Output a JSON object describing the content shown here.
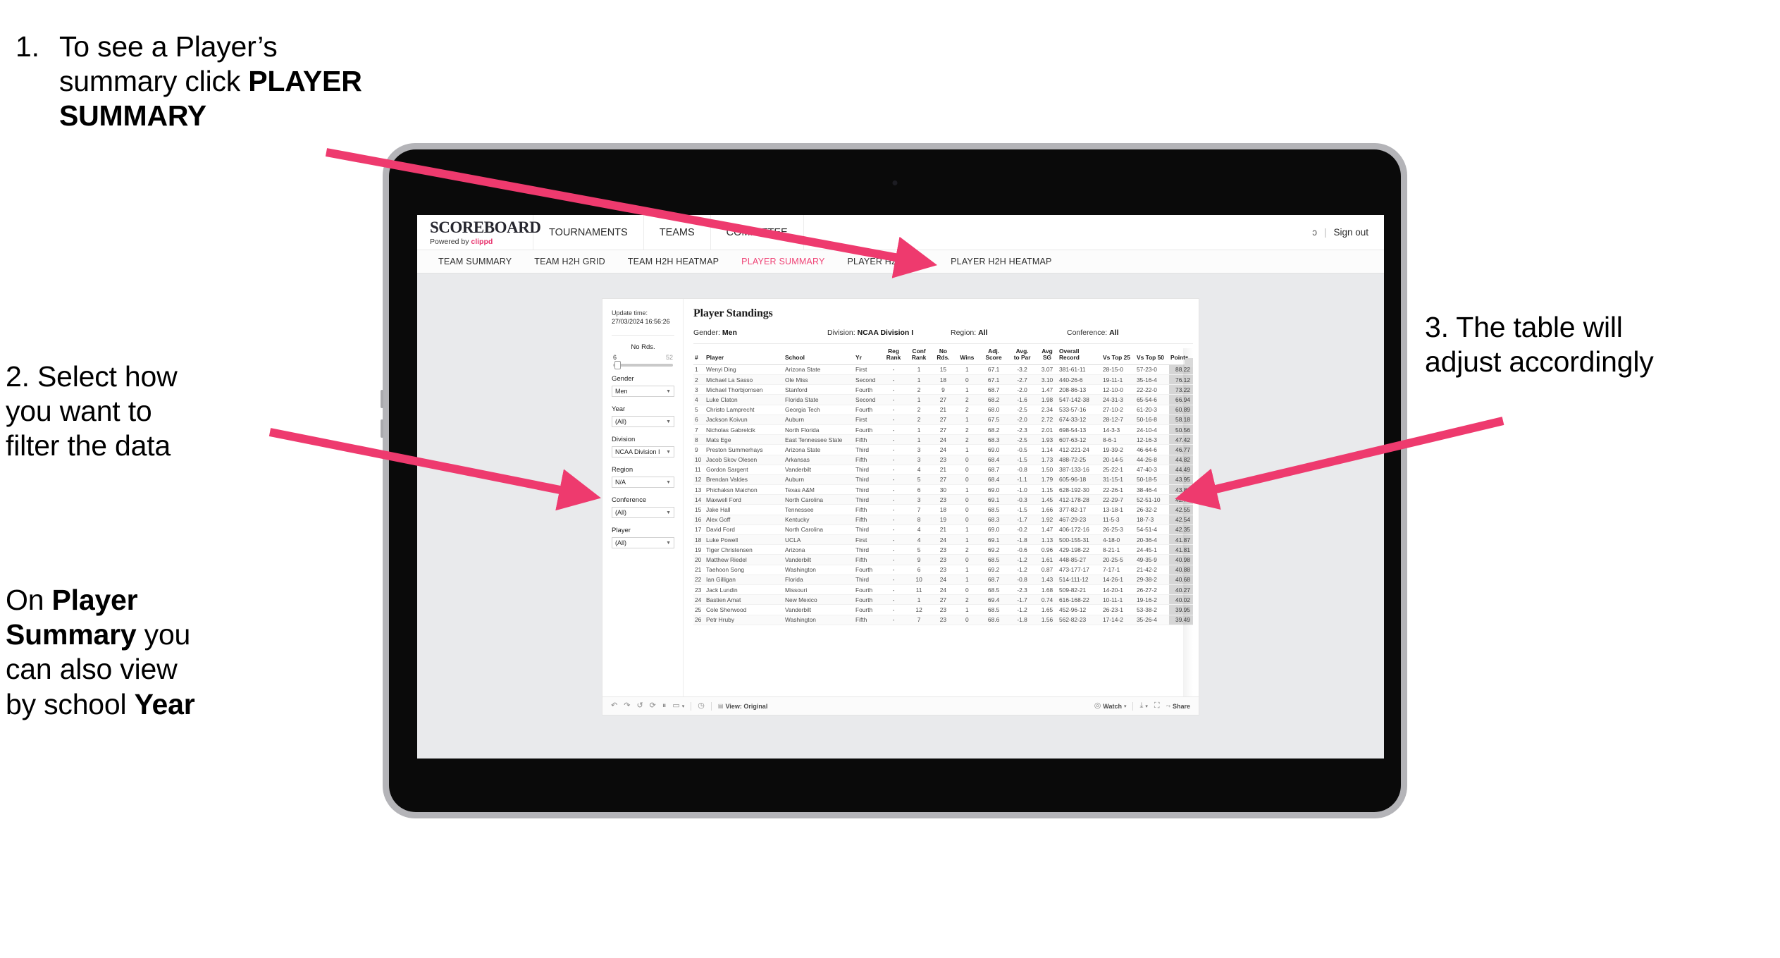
{
  "annotations": {
    "one": {
      "number": "1.",
      "line1": "To see a Player’s",
      "line2_pre": "summary click ",
      "line2_bold": "PLAYER",
      "line3_bold": "SUMMARY"
    },
    "two": {
      "line1": "2. Select how",
      "line2": "you want to",
      "line3": "filter the data"
    },
    "two_b": {
      "pre1": "On ",
      "bold1": "Player",
      "bold2": "Summary",
      "mid": " you",
      "line3": "can also view",
      "line4_pre": "by school ",
      "line4_bold": "Year"
    },
    "three": {
      "line1": "3. The table will",
      "line2": "adjust accordingly"
    }
  },
  "colors": {
    "accent_pink": "#ef4376",
    "arrow_pink": "#ee3a6e",
    "brand_dark": "#27272f",
    "points_cell": "#d6d6d6"
  },
  "app": {
    "brand": {
      "name": "SCOREBOARD",
      "powered_prefix": "Powered by ",
      "powered_brand": "clippd"
    },
    "top_nav": [
      "TOURNAMENTS",
      "TEAMS",
      "COMMITTEE"
    ],
    "header_right": {
      "truncated": "ɔ",
      "divider": "|",
      "sign_out": "Sign out"
    },
    "sub_nav": [
      {
        "label": "TEAM SUMMARY",
        "active": false
      },
      {
        "label": "TEAM H2H GRID",
        "active": false
      },
      {
        "label": "TEAM H2H HEATMAP",
        "active": false
      },
      {
        "label": "PLAYER SUMMARY",
        "active": true
      },
      {
        "label": "PLAYER H2H GRID",
        "active": false
      },
      {
        "label": "PLAYER H2H HEATMAP",
        "active": false
      }
    ]
  },
  "viz": {
    "update": {
      "label": "Update time:",
      "value": "27/03/2024 16:56:26"
    },
    "filters": {
      "no_rds": {
        "title": "No Rds.",
        "min": "6",
        "max": "52"
      },
      "gender": {
        "title": "Gender",
        "value": "Men"
      },
      "year": {
        "title": "Year",
        "value": "(All)"
      },
      "division": {
        "title": "Division",
        "value": "NCAA Division I"
      },
      "region": {
        "title": "Region",
        "value": "N/A"
      },
      "conference": {
        "title": "Conference",
        "value": "(All)"
      },
      "player": {
        "title": "Player",
        "value": "(All)"
      }
    },
    "title": "Player Standings",
    "summary": [
      {
        "label": "Gender:",
        "value": "Men"
      },
      {
        "label": "Division:",
        "value": "NCAA Division I"
      },
      {
        "label": "Region:",
        "value": "All"
      },
      {
        "label": "Conference:",
        "value": "All"
      }
    ],
    "toolbar": {
      "view_label": "View: Original",
      "watch_label": "Watch",
      "share_label": "Share"
    }
  },
  "table": {
    "columns": [
      {
        "key": "num",
        "l1": "#",
        "l2": ""
      },
      {
        "key": "player",
        "l1": "Player",
        "l2": ""
      },
      {
        "key": "school",
        "l1": "School",
        "l2": ""
      },
      {
        "key": "yr",
        "l1": "Yr",
        "l2": ""
      },
      {
        "key": "reg_rank",
        "l1": "Reg",
        "l2": "Rank"
      },
      {
        "key": "conf_rank",
        "l1": "Conf",
        "l2": "Rank"
      },
      {
        "key": "no_rds",
        "l1": "No",
        "l2": "Rds."
      },
      {
        "key": "wins",
        "l1": "Wins",
        "l2": ""
      },
      {
        "key": "adj_score",
        "l1": "Adj.",
        "l2": "Score"
      },
      {
        "key": "avg_to_par",
        "l1": "Avg.",
        "l2": "to Par"
      },
      {
        "key": "avg_sg",
        "l1": "Avg",
        "l2": "SG"
      },
      {
        "key": "overall_record",
        "l1": "Overall",
        "l2": "Record"
      },
      {
        "key": "vs_top_25",
        "l1": "Vs Top 25",
        "l2": ""
      },
      {
        "key": "vs_top_50",
        "l1": "Vs Top 50",
        "l2": ""
      },
      {
        "key": "points",
        "l1": "Points",
        "l2": ""
      }
    ],
    "rows": [
      [
        "1",
        "Wenyi Ding",
        "Arizona State",
        "First",
        "-",
        "1",
        "15",
        "1",
        "67.1",
        "-3.2",
        "3.07",
        "381-61-11",
        "28-15-0",
        "57-23-0",
        "88.22"
      ],
      [
        "2",
        "Michael La Sasso",
        "Ole Miss",
        "Second",
        "-",
        "1",
        "18",
        "0",
        "67.1",
        "-2.7",
        "3.10",
        "440-26-6",
        "19-11-1",
        "35-16-4",
        "76.12"
      ],
      [
        "3",
        "Michael Thorbjornsen",
        "Stanford",
        "Fourth",
        "-",
        "2",
        "9",
        "1",
        "68.7",
        "-2.0",
        "1.47",
        "208-86-13",
        "12-10-0",
        "22-22-0",
        "73.22"
      ],
      [
        "4",
        "Luke Claton",
        "Florida State",
        "Second",
        "-",
        "1",
        "27",
        "2",
        "68.2",
        "-1.6",
        "1.98",
        "547-142-38",
        "24-31-3",
        "65-54-6",
        "66.94"
      ],
      [
        "5",
        "Christo Lamprecht",
        "Georgia Tech",
        "Fourth",
        "-",
        "2",
        "21",
        "2",
        "68.0",
        "-2.5",
        "2.34",
        "533-57-16",
        "27-10-2",
        "61-20-3",
        "60.89"
      ],
      [
        "6",
        "Jackson Koivun",
        "Auburn",
        "First",
        "-",
        "2",
        "27",
        "1",
        "67.5",
        "-2.0",
        "2.72",
        "674-33-12",
        "28-12-7",
        "50-16-8",
        "58.18"
      ],
      [
        "7",
        "Nicholas Gabrelcik",
        "North Florida",
        "Fourth",
        "-",
        "1",
        "27",
        "2",
        "68.2",
        "-2.3",
        "2.01",
        "698-54-13",
        "14-3-3",
        "24-10-4",
        "50.56"
      ],
      [
        "8",
        "Mats Ege",
        "East Tennessee State",
        "Fifth",
        "-",
        "1",
        "24",
        "2",
        "68.3",
        "-2.5",
        "1.93",
        "607-63-12",
        "8-6-1",
        "12-16-3",
        "47.42"
      ],
      [
        "9",
        "Preston Summerhays",
        "Arizona State",
        "Third",
        "-",
        "3",
        "24",
        "1",
        "69.0",
        "-0.5",
        "1.14",
        "412-221-24",
        "19-39-2",
        "46-64-6",
        "46.77"
      ],
      [
        "10",
        "Jacob Skov Olesen",
        "Arkansas",
        "Fifth",
        "-",
        "3",
        "23",
        "0",
        "68.4",
        "-1.5",
        "1.73",
        "488-72-25",
        "20-14-5",
        "44-26-8",
        "44.82"
      ],
      [
        "11",
        "Gordon Sargent",
        "Vanderbilt",
        "Third",
        "-",
        "4",
        "21",
        "0",
        "68.7",
        "-0.8",
        "1.50",
        "387-133-16",
        "25-22-1",
        "47-40-3",
        "44.49"
      ],
      [
        "12",
        "Brendan Valdes",
        "Auburn",
        "Third",
        "-",
        "5",
        "27",
        "0",
        "68.4",
        "-1.1",
        "1.79",
        "605-96-18",
        "31-15-1",
        "50-18-5",
        "43.95"
      ],
      [
        "13",
        "Phichaksn Maichon",
        "Texas A&M",
        "Third",
        "-",
        "6",
        "30",
        "1",
        "69.0",
        "-1.0",
        "1.15",
        "628-192-30",
        "22-26-1",
        "38-46-4",
        "43.83"
      ],
      [
        "14",
        "Maxwell Ford",
        "North Carolina",
        "Third",
        "-",
        "3",
        "23",
        "0",
        "69.1",
        "-0.3",
        "1.45",
        "412-178-28",
        "22-29-7",
        "52-51-10",
        "42.75"
      ],
      [
        "15",
        "Jake Hall",
        "Tennessee",
        "Fifth",
        "-",
        "7",
        "18",
        "0",
        "68.5",
        "-1.5",
        "1.66",
        "377-82-17",
        "13-18-1",
        "26-32-2",
        "42.55"
      ],
      [
        "16",
        "Alex Goff",
        "Kentucky",
        "Fifth",
        "-",
        "8",
        "19",
        "0",
        "68.3",
        "-1.7",
        "1.92",
        "467-29-23",
        "11-5-3",
        "18-7-3",
        "42.54"
      ],
      [
        "17",
        "David Ford",
        "North Carolina",
        "Third",
        "-",
        "4",
        "21",
        "1",
        "69.0",
        "-0.2",
        "1.47",
        "406-172-16",
        "26-25-3",
        "54-51-4",
        "42.35"
      ],
      [
        "18",
        "Luke Powell",
        "UCLA",
        "First",
        "-",
        "4",
        "24",
        "1",
        "69.1",
        "-1.8",
        "1.13",
        "500-155-31",
        "4-18-0",
        "20-36-4",
        "41.87"
      ],
      [
        "19",
        "Tiger Christensen",
        "Arizona",
        "Third",
        "-",
        "5",
        "23",
        "2",
        "69.2",
        "-0.6",
        "0.96",
        "429-198-22",
        "8-21-1",
        "24-45-1",
        "41.81"
      ],
      [
        "20",
        "Matthew Riedel",
        "Vanderbilt",
        "Fifth",
        "-",
        "9",
        "23",
        "0",
        "68.5",
        "-1.2",
        "1.61",
        "448-85-27",
        "20-25-5",
        "49-35-9",
        "40.98"
      ],
      [
        "21",
        "Taehoon Song",
        "Washington",
        "Fourth",
        "-",
        "6",
        "23",
        "1",
        "69.2",
        "-1.2",
        "0.87",
        "473-177-17",
        "7-17-1",
        "21-42-2",
        "40.88"
      ],
      [
        "22",
        "Ian Gilligan",
        "Florida",
        "Third",
        "-",
        "10",
        "24",
        "1",
        "68.7",
        "-0.8",
        "1.43",
        "514-111-12",
        "14-26-1",
        "29-38-2",
        "40.68"
      ],
      [
        "23",
        "Jack Lundin",
        "Missouri",
        "Fourth",
        "-",
        "11",
        "24",
        "0",
        "68.5",
        "-2.3",
        "1.68",
        "509-82-21",
        "14-20-1",
        "26-27-2",
        "40.27"
      ],
      [
        "24",
        "Bastien Amat",
        "New Mexico",
        "Fourth",
        "-",
        "1",
        "27",
        "2",
        "69.4",
        "-1.7",
        "0.74",
        "616-168-22",
        "10-11-1",
        "19-16-2",
        "40.02"
      ],
      [
        "25",
        "Cole Sherwood",
        "Vanderbilt",
        "Fourth",
        "-",
        "12",
        "23",
        "1",
        "68.5",
        "-1.2",
        "1.65",
        "452-96-12",
        "26-23-1",
        "53-38-2",
        "39.95"
      ],
      [
        "26",
        "Petr Hruby",
        "Washington",
        "Fifth",
        "-",
        "7",
        "23",
        "0",
        "68.6",
        "-1.8",
        "1.56",
        "562-82-23",
        "17-14-2",
        "35-26-4",
        "39.49"
      ]
    ]
  }
}
